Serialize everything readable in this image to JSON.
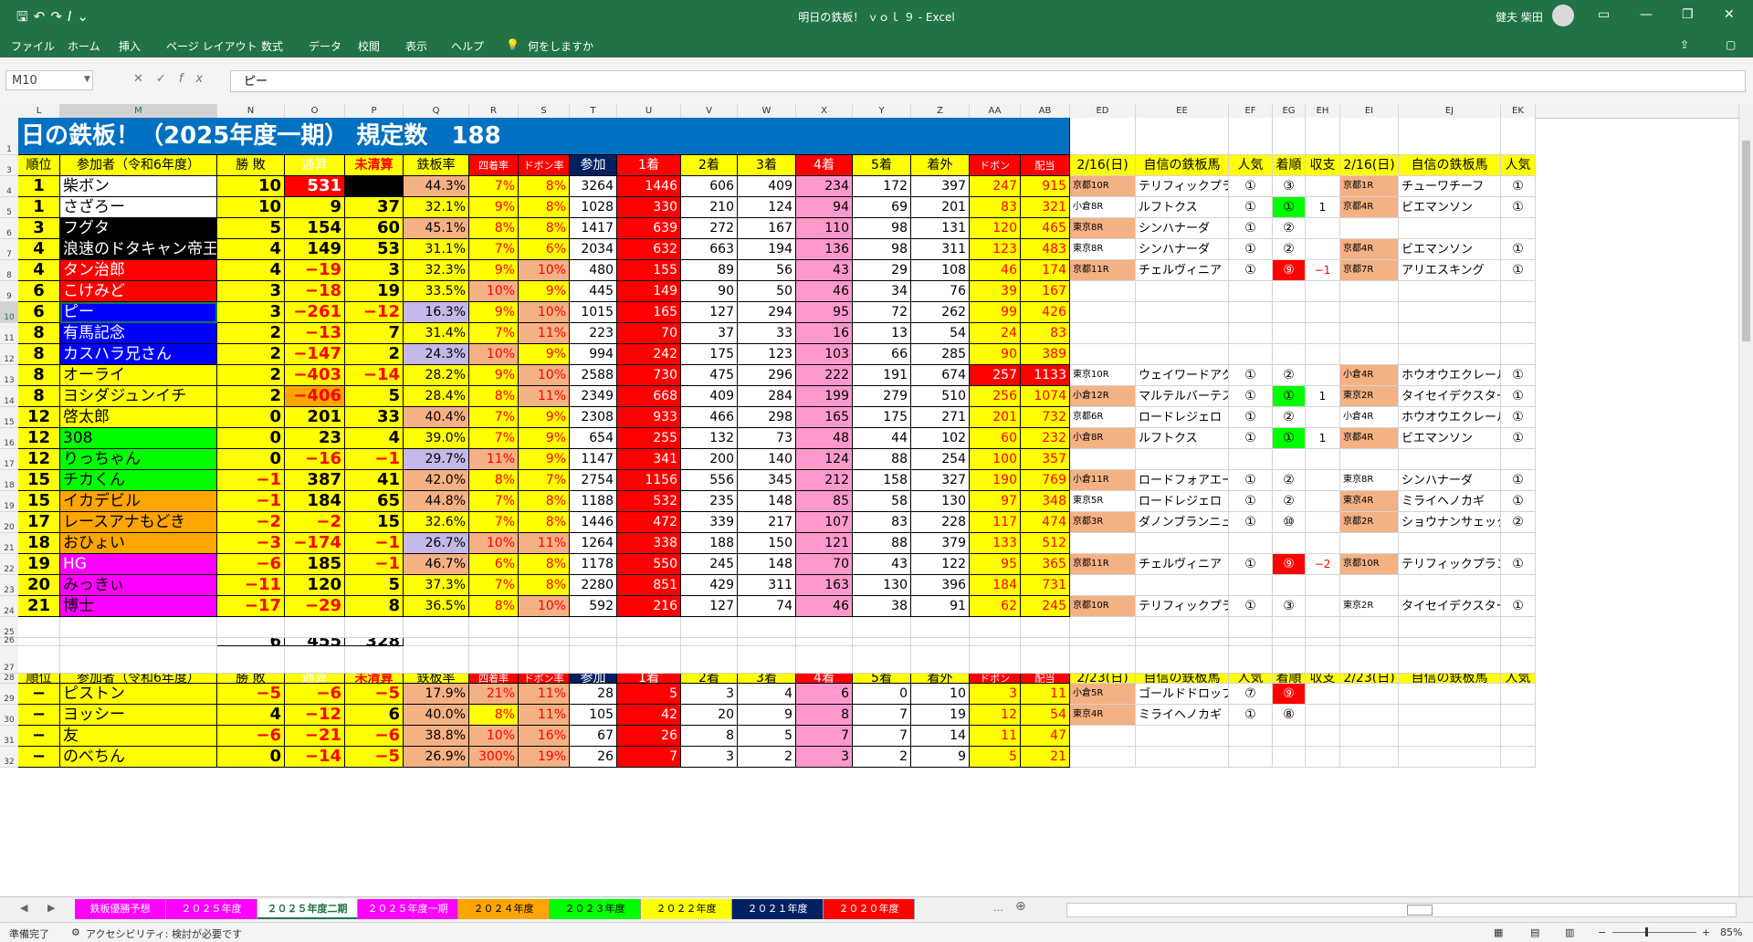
{
  "window": {
    "title": "明日の鉄板！ ｖｏｌ ９ - Excel",
    "user": "健夫 柴田",
    "qat_icons": [
      "save-icon",
      "undo-icon",
      "redo-icon",
      "italic-icon",
      "customize-icon"
    ]
  },
  "ribbon": {
    "tabs": [
      "ファイル",
      "ホーム",
      "挿入",
      "ページ レイアウト",
      "数式",
      "データ",
      "校閲",
      "表示",
      "ヘルプ"
    ],
    "tell_me": "何をしますか"
  },
  "formula_bar": {
    "name_box": "M10",
    "content": "ピー"
  },
  "columns": [
    "L",
    "M",
    "N",
    "O",
    "P",
    "Q",
    "R",
    "S",
    "T",
    "U",
    "V",
    "W",
    "X",
    "Y",
    "Z",
    "AA",
    "AB",
    "ED",
    "EE",
    "EF",
    "EG",
    "EH",
    "EI",
    "EJ",
    "EK"
  ],
  "row_numbers": [
    "1",
    "3",
    "4",
    "5",
    "6",
    "7",
    "8",
    "9",
    "10",
    "11",
    "12",
    "13",
    "14",
    "15",
    "16",
    "17",
    "18",
    "19",
    "20",
    "21",
    "22",
    "23",
    "24",
    "25",
    "26",
    "27",
    "28",
    "29",
    "30",
    "31",
    "32"
  ],
  "banner": "日の鉄板！（2025年度一期）  規定数　188",
  "table1": {
    "headers": [
      "順位",
      "参加者（令和6年度）",
      "勝 敗",
      "通算",
      "未清算",
      "鉄板率",
      "四着率",
      "ドボン率",
      "参加",
      "1着",
      "2着",
      "3着",
      "4着",
      "5着",
      "着外",
      "ドボン",
      "配当",
      "2/16(日)",
      "自信の鉄板馬",
      "人気",
      "着順",
      "収支",
      "2/16(日)",
      "自信の鉄板馬",
      "人気"
    ],
    "rows": [
      [
        "1",
        "柴ボン",
        "10",
        "531",
        "",
        "44.3%",
        "7%",
        "8%",
        "3264",
        "1446",
        "606",
        "409",
        "234",
        "172",
        "397",
        "247",
        "915",
        "京都10R",
        "テリフィックプラン",
        "①",
        "③",
        "",
        "京都1R",
        "チューワチーフ",
        "①"
      ],
      [
        "1",
        "さざろー",
        "10",
        "9",
        "37",
        "32.1%",
        "9%",
        "8%",
        "1028",
        "330",
        "210",
        "124",
        "94",
        "69",
        "201",
        "83",
        "321",
        "小倉8R",
        "ルフトクス",
        "①",
        "①",
        "1",
        "京都4R",
        "ビエマンソン",
        "①"
      ],
      [
        "3",
        "フグタ",
        "5",
        "154",
        "60",
        "45.1%",
        "8%",
        "8%",
        "1417",
        "639",
        "272",
        "167",
        "110",
        "98",
        "131",
        "120",
        "465",
        "東京8R",
        "シンハナーダ",
        "①",
        "②",
        "",
        "",
        "",
        ""
      ],
      [
        "4",
        "浪速のドタキャン帝王",
        "4",
        "149",
        "53",
        "31.1%",
        "7%",
        "6%",
        "2034",
        "632",
        "663",
        "194",
        "136",
        "98",
        "311",
        "123",
        "483",
        "東京8R",
        "シンハナーダ",
        "①",
        "②",
        "",
        "京都4R",
        "ビエマンソン",
        "①"
      ],
      [
        "4",
        "タン治郎",
        "4",
        "−19",
        "3",
        "32.3%",
        "9%",
        "10%",
        "480",
        "155",
        "89",
        "56",
        "43",
        "29",
        "108",
        "46",
        "174",
        "京都11R",
        "チェルヴィニア",
        "①",
        "⑨",
        "−1",
        "京都7R",
        "アリエスキング",
        "①"
      ],
      [
        "6",
        "こけみど",
        "3",
        "−18",
        "19",
        "33.5%",
        "10%",
        "9%",
        "445",
        "149",
        "90",
        "50",
        "46",
        "34",
        "76",
        "39",
        "167",
        "",
        "",
        "",
        "",
        "",
        "",
        "",
        ""
      ],
      [
        "6",
        "ピー",
        "3",
        "−261",
        "−12",
        "16.3%",
        "9%",
        "10%",
        "1015",
        "165",
        "127",
        "294",
        "95",
        "72",
        "262",
        "99",
        "426",
        "",
        "",
        "",
        "",
        "",
        "",
        "",
        ""
      ],
      [
        "8",
        "有馬記念",
        "2",
        "−13",
        "7",
        "31.4%",
        "7%",
        "11%",
        "223",
        "70",
        "37",
        "33",
        "16",
        "13",
        "54",
        "24",
        "83",
        "",
        "",
        "",
        "",
        "",
        "",
        "",
        ""
      ],
      [
        "8",
        "カスハラ兄さん",
        "2",
        "−147",
        "2",
        "24.3%",
        "10%",
        "9%",
        "994",
        "242",
        "175",
        "123",
        "103",
        "66",
        "285",
        "90",
        "389",
        "",
        "",
        "",
        "",
        "",
        "",
        "",
        ""
      ],
      [
        "8",
        "オーライ",
        "2",
        "−403",
        "−14",
        "28.2%",
        "9%",
        "10%",
        "2588",
        "730",
        "475",
        "296",
        "222",
        "191",
        "674",
        "257",
        "1133",
        "東京10R",
        "ウェイワードアクト",
        "①",
        "②",
        "",
        "小倉4R",
        "ホウオウエクレール",
        "①"
      ],
      [
        "8",
        "ヨシダジュンイチ",
        "2",
        "−406",
        "5",
        "28.4%",
        "8%",
        "11%",
        "2349",
        "668",
        "409",
        "284",
        "199",
        "279",
        "510",
        "256",
        "1074",
        "小倉12R",
        "マルテルバーテスク",
        "①",
        "①",
        "1",
        "東京2R",
        "タイセイデクスター",
        "①"
      ],
      [
        "12",
        "啓太郎",
        "0",
        "201",
        "33",
        "40.4%",
        "7%",
        "9%",
        "2308",
        "933",
        "466",
        "298",
        "165",
        "175",
        "271",
        "201",
        "732",
        "京都6R",
        "ロードレジェロ",
        "①",
        "②",
        "",
        "小倉4R",
        "ホウオウエクレール",
        "①"
      ],
      [
        "12",
        "308",
        "0",
        "23",
        "4",
        "39.0%",
        "7%",
        "9%",
        "654",
        "255",
        "132",
        "73",
        "48",
        "44",
        "102",
        "60",
        "232",
        "小倉8R",
        "ルフトクス",
        "①",
        "①",
        "1",
        "京都4R",
        "ビエマンソン",
        "①"
      ],
      [
        "12",
        "りっちゃん",
        "0",
        "−16",
        "−1",
        "29.7%",
        "11%",
        "9%",
        "1147",
        "341",
        "200",
        "140",
        "124",
        "88",
        "254",
        "100",
        "357",
        "",
        "",
        "",
        "",
        "",
        "",
        "",
        ""
      ],
      [
        "15",
        "チカくん",
        "−1",
        "387",
        "41",
        "42.0%",
        "8%",
        "7%",
        "2754",
        "1156",
        "556",
        "345",
        "212",
        "158",
        "327",
        "190",
        "769",
        "小倉11R",
        "ロードフォアエース",
        "①",
        "②",
        "",
        "東京8R",
        "シンハナーダ",
        "①"
      ],
      [
        "15",
        "イカデビル",
        "−1",
        "184",
        "65",
        "44.8%",
        "7%",
        "8%",
        "1188",
        "532",
        "235",
        "148",
        "85",
        "58",
        "130",
        "97",
        "348",
        "東京5R",
        "ロードレジェロ",
        "①",
        "②",
        "",
        "東京4R",
        "ミライヘノカギ",
        "①"
      ],
      [
        "17",
        "レースアナもどき",
        "−2",
        "−2",
        "15",
        "32.6%",
        "7%",
        "8%",
        "1446",
        "472",
        "339",
        "217",
        "107",
        "83",
        "228",
        "117",
        "474",
        "京都3R",
        "ダノンブランニュ",
        "①",
        "⑩",
        "",
        "京都2R",
        "ショウナンサェッタ",
        "②"
      ],
      [
        "18",
        "おひょい",
        "−3",
        "−174",
        "−1",
        "26.7%",
        "10%",
        "11%",
        "1264",
        "338",
        "188",
        "150",
        "121",
        "88",
        "379",
        "133",
        "512",
        "",
        "",
        "",
        "",
        "",
        "",
        "",
        ""
      ],
      [
        "19",
        "HG",
        "−6",
        "185",
        "−1",
        "46.7%",
        "6%",
        "8%",
        "1178",
        "550",
        "245",
        "148",
        "70",
        "43",
        "122",
        "95",
        "365",
        "京都11R",
        "チェルヴィニア",
        "①",
        "⑨",
        "−2",
        "京都10R",
        "テリフィックプラン",
        "①"
      ],
      [
        "20",
        "みっきぃ",
        "−11",
        "120",
        "5",
        "37.3%",
        "7%",
        "8%",
        "2280",
        "851",
        "429",
        "311",
        "163",
        "130",
        "396",
        "184",
        "731",
        "",
        "",
        "",
        "",
        "",
        "",
        "",
        ""
      ],
      [
        "21",
        "博士",
        "−17",
        "−29",
        "8",
        "36.5%",
        "8%",
        "10%",
        "592",
        "216",
        "127",
        "74",
        "46",
        "38",
        "91",
        "62",
        "245",
        "京都10R",
        "テリフィックプラン",
        "①",
        "③",
        "",
        "東京2R",
        "タイセイデクスター",
        "①"
      ]
    ],
    "totals": [
      "6",
      "455",
      "328"
    ]
  },
  "table2": {
    "headers": [
      "順位",
      "参加者（令和6年度）",
      "勝 敗",
      "通算",
      "未清算",
      "鉄板率",
      "四着率",
      "ドボン率",
      "参加",
      "1着",
      "2着",
      "3着",
      "4着",
      "5着",
      "着外",
      "ドボン",
      "配当",
      "2/23(日)",
      "自信の鉄板馬",
      "人気",
      "着順",
      "収支",
      "2/23(日)",
      "自信の鉄板馬",
      "人気"
    ],
    "rows": [
      [
        "−",
        "ピストン",
        "−5",
        "−6",
        "−5",
        "17.9%",
        "21%",
        "11%",
        "28",
        "5",
        "3",
        "4",
        "6",
        "0",
        "10",
        "3",
        "11",
        "小倉5R",
        "ゴールドドロップ",
        "⑦",
        "⑨",
        "",
        "",
        "",
        ""
      ],
      [
        "−",
        "ヨッシー",
        "4",
        "−12",
        "6",
        "40.0%",
        "8%",
        "11%",
        "105",
        "42",
        "20",
        "9",
        "8",
        "7",
        "19",
        "12",
        "54",
        "東京4R",
        "ミライヘノカギ",
        "①",
        "⑧",
        "",
        "",
        "",
        ""
      ],
      [
        "−",
        "友",
        "−6",
        "−21",
        "−6",
        "38.8%",
        "10%",
        "16%",
        "67",
        "26",
        "8",
        "5",
        "7",
        "7",
        "14",
        "11",
        "47",
        "",
        "",
        "",
        "",
        "",
        "",
        "",
        ""
      ],
      [
        "−",
        "のべちん",
        "0",
        "−14",
        "−5",
        "26.9%",
        "300%",
        "19%",
        "26",
        "7",
        "3",
        "2",
        "3",
        "2",
        "9",
        "5",
        "21",
        "",
        "",
        "",
        "",
        "",
        "",
        "",
        ""
      ]
    ]
  },
  "sheet_tabs": [
    "鉄板優勝予想",
    "２０２５年度",
    "２０２５年度二期",
    "２０２５年度一期",
    "２０２４年度",
    "２０２３年度",
    "２０２２年度",
    "２０２１年度",
    "２０２０年度"
  ],
  "active_tab": "２０２５年度二期",
  "status": {
    "ready": "準備完了",
    "accessibility": "アクセシビリティ: 検討が必要です",
    "zoom": "85%"
  },
  "colors": {
    "excel_green": "#217346",
    "yellow": "#ffff00",
    "red": "#ff0000",
    "pink": "#ff99cc",
    "salmon": "#f4b183",
    "lavender": "#c5b8e8",
    "orange": "#ffa500",
    "green": "#00ff00",
    "magenta": "#ff00ff",
    "blue": "#0000ff",
    "dark_blue": "#002060",
    "banner_blue": "#0070c0"
  }
}
